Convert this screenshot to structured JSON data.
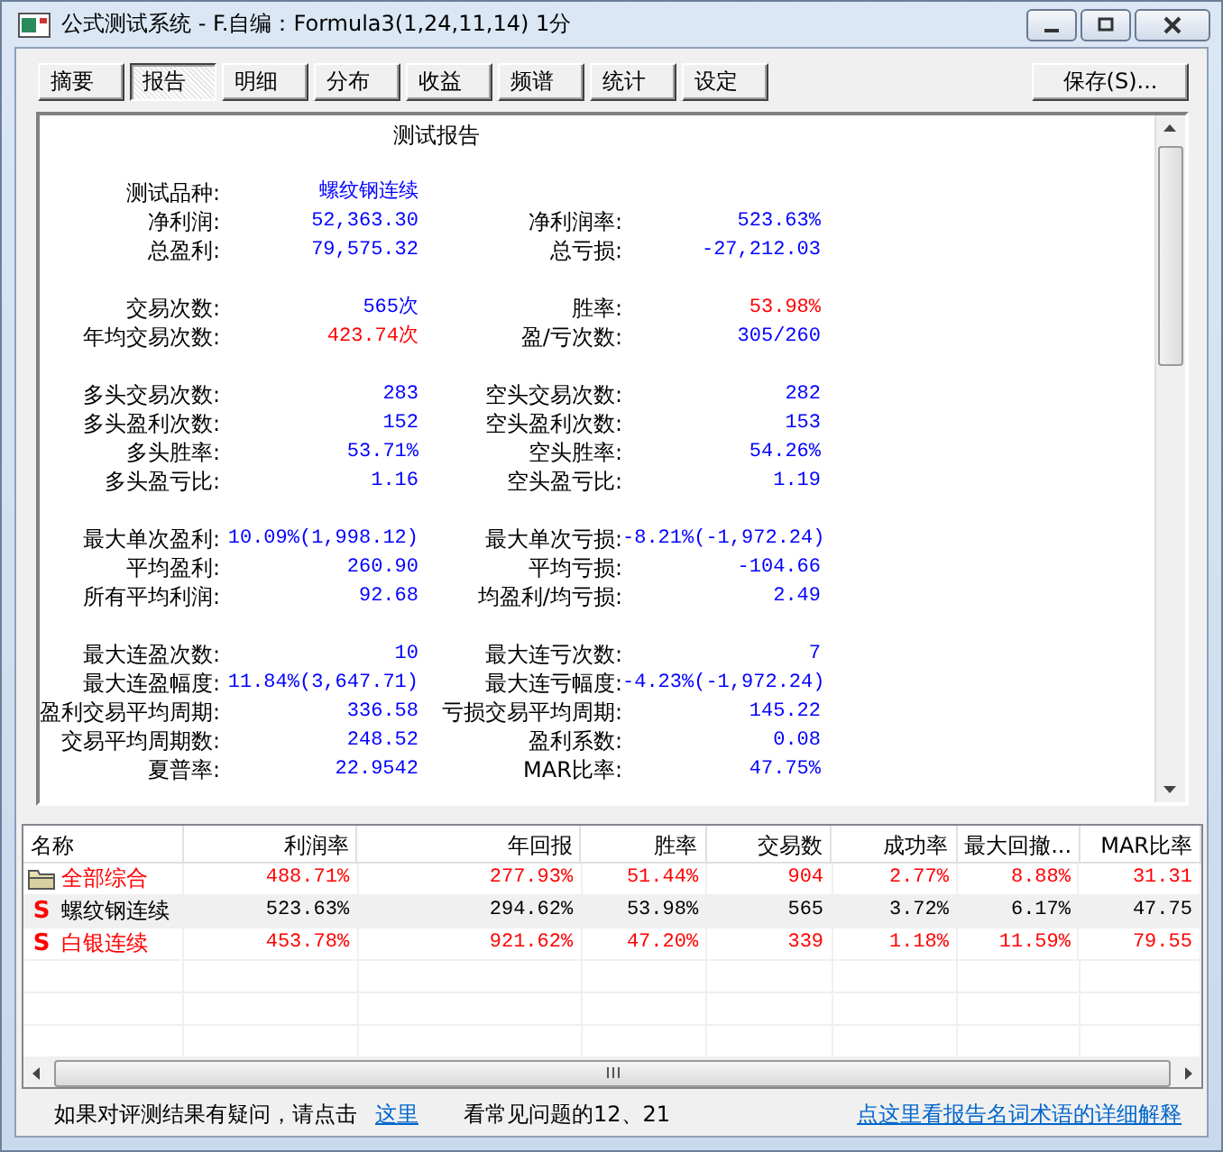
{
  "window": {
    "title": "公式测试系统 - F.自编：Formula3(1,24,11,14) 1分"
  },
  "tabs": [
    {
      "label": "摘要",
      "selected": false
    },
    {
      "label": "报告",
      "selected": true
    },
    {
      "label": "明细",
      "selected": false
    },
    {
      "label": "分布",
      "selected": false
    },
    {
      "label": "收益",
      "selected": false
    },
    {
      "label": "频谱",
      "selected": false
    },
    {
      "label": "统计",
      "selected": false
    },
    {
      "label": "设定",
      "selected": false
    }
  ],
  "save_button": "保存(S)...",
  "report": {
    "title": "测试报告",
    "groups": [
      {
        "rows": [
          {
            "left": {
              "label": "测试品种:",
              "value": "螺纹钢连续",
              "color": "#0000ff"
            }
          },
          {
            "left": {
              "label": "净利润:",
              "value": "52,363.30",
              "color": "#0000ff"
            },
            "right": {
              "label": "净利润率:",
              "value": "523.63%",
              "color": "#0000ff"
            }
          },
          {
            "left": {
              "label": "总盈利:",
              "value": "79,575.32",
              "color": "#0000ff"
            },
            "right": {
              "label": "总亏损:",
              "value": "-27,212.03",
              "color": "#0000ff"
            }
          }
        ]
      },
      {
        "rows": [
          {
            "left": {
              "label": "交易次数:",
              "value": "565次",
              "color": "#0000ff"
            },
            "right": {
              "label": "胜率:",
              "value": "53.98%",
              "color": "#ff0000"
            }
          },
          {
            "left": {
              "label": "年均交易次数:",
              "value": "423.74次",
              "color": "#ff0000"
            },
            "right": {
              "label": "盈/亏次数:",
              "value": "305/260",
              "color": "#0000ff"
            }
          }
        ]
      },
      {
        "rows": [
          {
            "left": {
              "label": "多头交易次数:",
              "value": "283",
              "color": "#0000ff"
            },
            "right": {
              "label": "空头交易次数:",
              "value": "282",
              "color": "#0000ff"
            }
          },
          {
            "left": {
              "label": "多头盈利次数:",
              "value": "152",
              "color": "#0000ff"
            },
            "right": {
              "label": "空头盈利次数:",
              "value": "153",
              "color": "#0000ff"
            }
          },
          {
            "left": {
              "label": "多头胜率:",
              "value": "53.71%",
              "color": "#0000ff"
            },
            "right": {
              "label": "空头胜率:",
              "value": "54.26%",
              "color": "#0000ff"
            }
          },
          {
            "left": {
              "label": "多头盈亏比:",
              "value": "1.16",
              "color": "#0000ff"
            },
            "right": {
              "label": "空头盈亏比:",
              "value": "1.19",
              "color": "#0000ff"
            }
          }
        ]
      },
      {
        "rows": [
          {
            "left": {
              "label": "最大单次盈利:",
              "value": "10.09%(1,998.12)",
              "color": "#0000ff"
            },
            "right": {
              "label": "最大单次亏损:",
              "value": "-8.21%(-1,972.24)",
              "color": "#0000ff"
            }
          },
          {
            "left": {
              "label": "平均盈利:",
              "value": "260.90",
              "color": "#0000ff"
            },
            "right": {
              "label": "平均亏损:",
              "value": "-104.66",
              "color": "#0000ff"
            }
          },
          {
            "left": {
              "label": "所有平均利润:",
              "value": "92.68",
              "color": "#0000ff"
            },
            "right": {
              "label": "均盈利/均亏损:",
              "value": "2.49",
              "color": "#0000ff"
            }
          }
        ]
      },
      {
        "rows": [
          {
            "left": {
              "label": "最大连盈次数:",
              "value": "10",
              "color": "#0000ff"
            },
            "right": {
              "label": "最大连亏次数:",
              "value": "7",
              "color": "#0000ff"
            }
          },
          {
            "left": {
              "label": "最大连盈幅度:",
              "value": "11.84%(3,647.71)",
              "color": "#0000ff"
            },
            "right": {
              "label": "最大连亏幅度:",
              "value": "-4.23%(-1,972.24)",
              "color": "#0000ff"
            }
          },
          {
            "left": {
              "label": "盈利交易平均周期:",
              "value": "336.58",
              "color": "#0000ff"
            },
            "right": {
              "label": "亏损交易平均周期:",
              "value": "145.22",
              "color": "#0000ff"
            }
          },
          {
            "left": {
              "label": "交易平均周期数:",
              "value": "248.52",
              "color": "#0000ff"
            },
            "right": {
              "label": "盈利系数:",
              "value": "0.08",
              "color": "#0000ff"
            }
          },
          {
            "left": {
              "label": "夏普率:",
              "value": "22.9542",
              "color": "#0000ff"
            },
            "right": {
              "label": "MAR比率:",
              "value": "47.75%",
              "color": "#0000ff"
            }
          }
        ]
      }
    ]
  },
  "table": {
    "columns": [
      "名称",
      "利润率",
      "年回报",
      "胜率",
      "交易数",
      "成功率",
      "最大回撤...",
      "MAR比率"
    ],
    "rows": [
      {
        "kind": "folder",
        "selected": false,
        "color": "#ff0000",
        "cells": [
          "全部综合",
          "488.71%",
          "277.93%",
          "51.44%",
          "904",
          "2.77%",
          "8.88%",
          "31.31"
        ]
      },
      {
        "kind": "symbol",
        "marker": "S",
        "selected": true,
        "color": "#000000",
        "cells": [
          "螺纹钢连续",
          "523.63%",
          "294.62%",
          "53.98%",
          "565",
          "3.72%",
          "6.17%",
          "47.75"
        ]
      },
      {
        "kind": "symbol",
        "marker": "S",
        "selected": false,
        "color": "#ff0000",
        "cells": [
          "白银连续",
          "453.78%",
          "921.62%",
          "47.20%",
          "339",
          "1.18%",
          "11.59%",
          "79.55"
        ]
      }
    ]
  },
  "footer": {
    "text": "如果对评测结果有疑问，请点击",
    "link": "这里",
    "faq": "看常见问题的12、21",
    "glossary_link": "点这里看报告名词术语的详细解释"
  }
}
